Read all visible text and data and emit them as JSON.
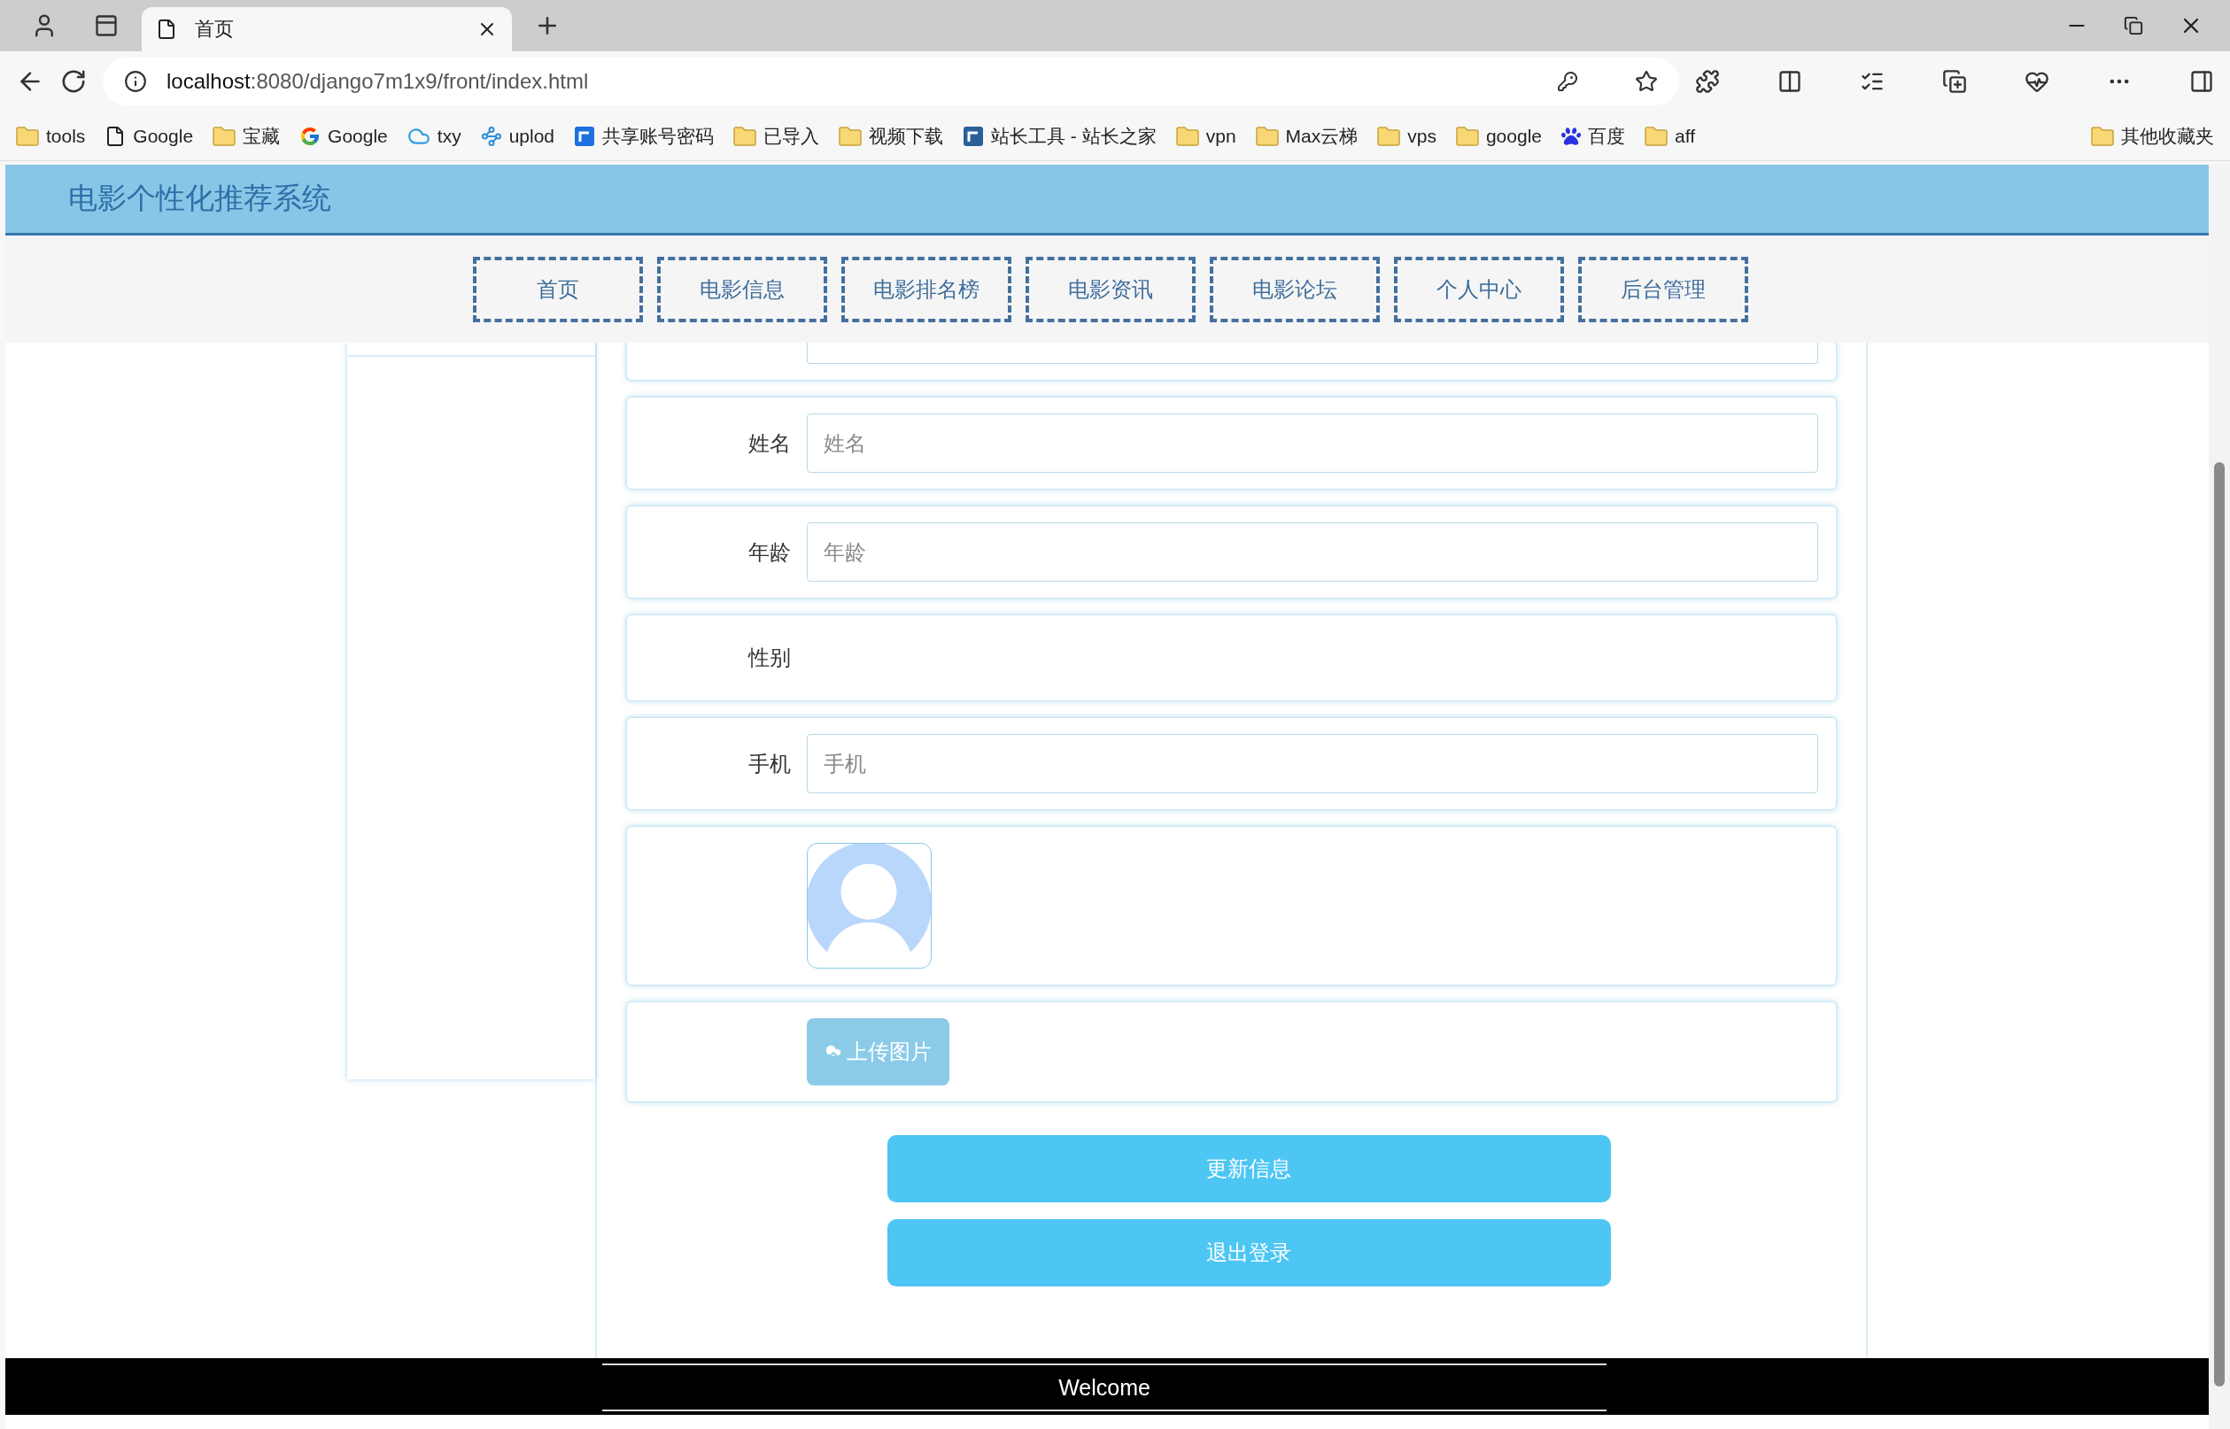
{
  "browser": {
    "tabs": [
      {
        "title": "首页",
        "selected": true
      }
    ],
    "url": {
      "host": "localhost",
      "path": ":8080/django7m1x9/front/index.html"
    },
    "bookmarks": [
      {
        "label": "tools",
        "kind": "folder"
      },
      {
        "label": "Google",
        "kind": "page"
      },
      {
        "label": "宝藏",
        "kind": "folder"
      },
      {
        "label": "Google",
        "kind": "google"
      },
      {
        "label": "txy",
        "kind": "cloud"
      },
      {
        "label": "uplod",
        "kind": "link"
      },
      {
        "label": "共享账号密码",
        "kind": "app"
      },
      {
        "label": "已导入",
        "kind": "folder"
      },
      {
        "label": "视频下载",
        "kind": "folder"
      },
      {
        "label": "站长工具 - 站长之家",
        "kind": "chart"
      },
      {
        "label": "vpn",
        "kind": "folder"
      },
      {
        "label": "Max云梯",
        "kind": "folder"
      },
      {
        "label": "vps",
        "kind": "folder"
      },
      {
        "label": "google",
        "kind": "folder"
      },
      {
        "label": "百度",
        "kind": "paw"
      },
      {
        "label": "aff",
        "kind": "folder"
      }
    ],
    "other_bookmarks": "其他收藏夹"
  },
  "site": {
    "title": "电影个性化推荐系统",
    "nav": [
      {
        "label": "首页"
      },
      {
        "label": "电影信息"
      },
      {
        "label": "电影排名榜"
      },
      {
        "label": "电影资讯"
      },
      {
        "label": "电影论坛"
      },
      {
        "label": "个人中心"
      },
      {
        "label": "后台管理"
      }
    ]
  },
  "form": {
    "fields": [
      {
        "kind": "partial"
      },
      {
        "kind": "input",
        "label": "姓名",
        "placeholder": "姓名"
      },
      {
        "kind": "input",
        "label": "年龄",
        "placeholder": "年龄"
      },
      {
        "kind": "select",
        "label": "性别"
      },
      {
        "kind": "input",
        "label": "手机",
        "placeholder": "手机"
      },
      {
        "kind": "avatar"
      },
      {
        "kind": "upload",
        "button": "上传图片"
      }
    ],
    "actions": [
      "更新信息",
      "退出登录"
    ]
  },
  "footer": {
    "text": "Welcome"
  }
}
